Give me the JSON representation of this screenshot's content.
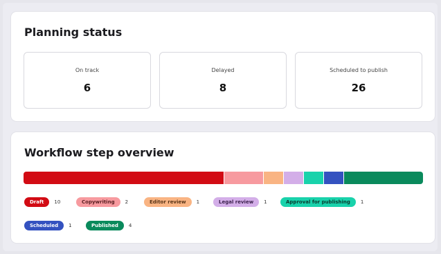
{
  "planning": {
    "title": "Planning status",
    "stats": [
      {
        "label": "On track",
        "value": "6"
      },
      {
        "label": "Delayed",
        "value": "8"
      },
      {
        "label": "Scheduled to publish",
        "value": "26"
      }
    ]
  },
  "workflow": {
    "title": "Workflow step overview",
    "steps": [
      {
        "label": "Draft",
        "count": "10",
        "value": 10,
        "color": "#d20b14",
        "text_color": "#ffffff"
      },
      {
        "label": "Copywriting",
        "count": "2",
        "value": 2,
        "color": "#f79a9f",
        "text_color": "#5a1f22"
      },
      {
        "label": "Editor review",
        "count": "1",
        "value": 1,
        "color": "#f9b483",
        "text_color": "#5a3518"
      },
      {
        "label": "Legal review",
        "count": "1",
        "value": 1,
        "color": "#d3aee8",
        "text_color": "#3e2350"
      },
      {
        "label": "Approval for publishing",
        "count": "1",
        "value": 1,
        "color": "#19d2ab",
        "text_color": "#0a3b30"
      },
      {
        "label": "Scheduled",
        "count": "1",
        "value": 1,
        "color": "#3452c0",
        "text_color": "#ffffff"
      },
      {
        "label": "Published",
        "count": "4",
        "value": 4,
        "color": "#0a8a5c",
        "text_color": "#ffffff"
      }
    ]
  }
}
